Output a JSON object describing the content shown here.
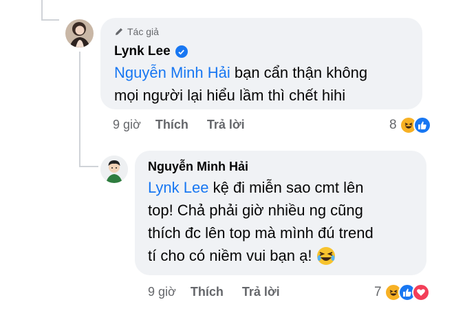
{
  "comment1": {
    "author_badge": "Tác giả",
    "author": "Lynk Lee",
    "mention": "Nguyễn Minh Hải",
    "text_line1": " bạn cẩn thận không",
    "text_line2": "mọi người lại hiểu lầm thì chết hihi",
    "time": "9 giờ",
    "like_label": "Thích",
    "reply_label": "Trả lời",
    "reaction_count": "8",
    "reactions": [
      "haha-icon",
      "like-icon"
    ]
  },
  "comment2": {
    "author": "Nguyễn Minh Hải",
    "mention": "Lynk Lee",
    "text_line1": " kệ đi miễn sao cmt lên",
    "text_line2": "top! Chả phải giờ nhiều ng cũng",
    "text_line3": "thích đc lên top mà mình đú trend",
    "text_line4": "tí cho có niềm vui bạn ạ!",
    "time": "9 giờ",
    "like_label": "Thích",
    "reply_label": "Trả lời",
    "reaction_count": "7",
    "reactions": [
      "haha-icon",
      "like-icon",
      "love-icon"
    ]
  },
  "colors": {
    "bubble": "#f0f2f5",
    "mention": "#1877f2",
    "meta": "#65676b"
  }
}
